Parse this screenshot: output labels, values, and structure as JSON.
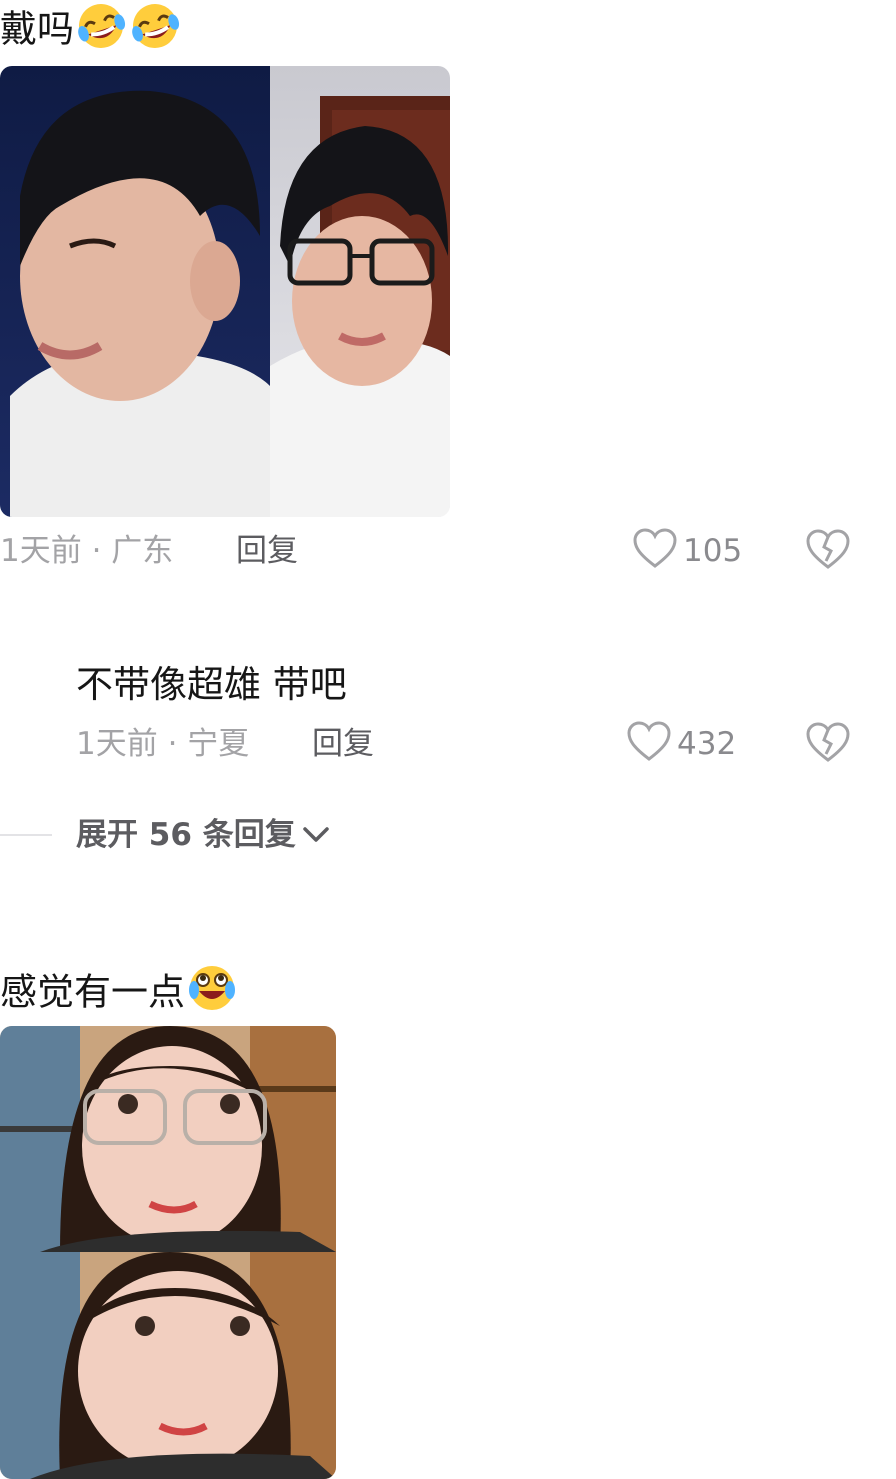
{
  "comment1": {
    "text": "戴吗",
    "emojis": [
      "rofl-emoji",
      "rofl-emoji"
    ],
    "meta": "1天前 · 广东",
    "reply_label": "回复",
    "likes": "105"
  },
  "reply1": {
    "text": "不带像超雄 带吧",
    "meta": "1天前 · 宁夏",
    "reply_label": "回复",
    "likes": "432"
  },
  "expand": {
    "label": "展开 56 条回复"
  },
  "comment2": {
    "text": "感觉有一点",
    "emojis": [
      "laugh-cry-emoji"
    ]
  },
  "colors": {
    "meta_gray": "#a3a3a6",
    "reply_gray": "#5c5c60",
    "text": "#161616"
  }
}
